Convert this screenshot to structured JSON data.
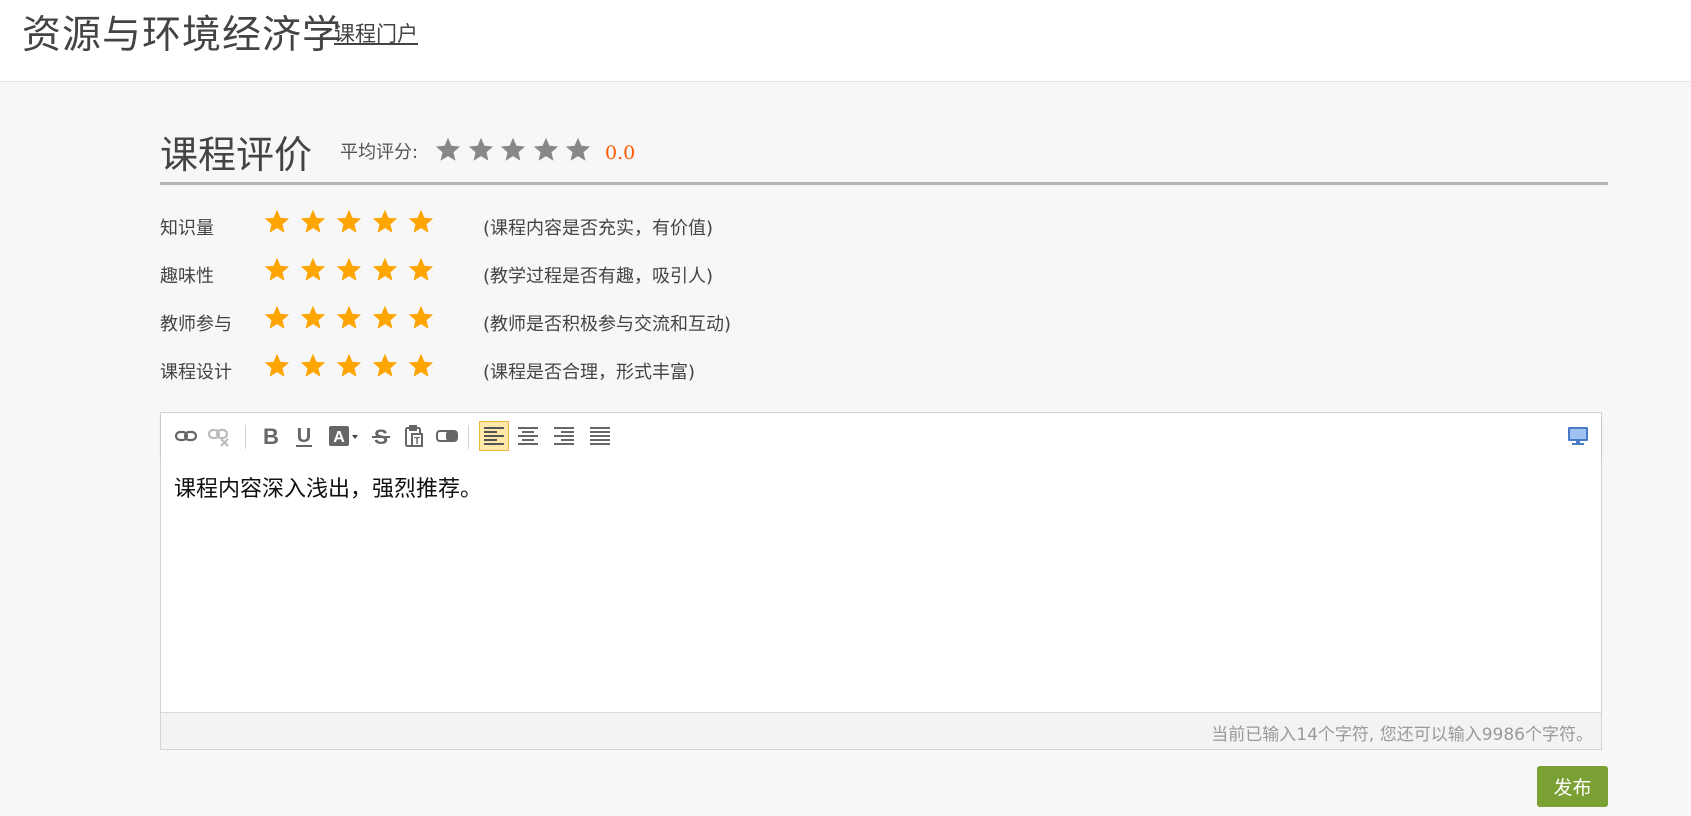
{
  "header": {
    "course_title": "资源与环境经济学",
    "portal_link": "课程门户"
  },
  "evaluation": {
    "title": "课程评价",
    "average_label": "平均评分:",
    "average_score": "0.0",
    "average_stars_filled": 0,
    "max_stars": 5,
    "colors": {
      "star_filled": "#ffa500",
      "star_empty": "#888888",
      "score": "#ff5a00"
    },
    "criteria": [
      {
        "label": "知识量",
        "hint": "(课程内容是否充实，有价值)",
        "stars": 5
      },
      {
        "label": "趣味性",
        "hint": "(教学过程是否有趣，吸引人)",
        "stars": 5
      },
      {
        "label": "教师参与",
        "hint": "(教师是否积极参与交流和互动)",
        "stars": 5
      },
      {
        "label": "课程设计",
        "hint": "(课程是否合理，形式丰富)",
        "stars": 5
      }
    ]
  },
  "editor": {
    "toolbar": [
      "link-icon",
      "unlink-icon",
      "bold-icon",
      "underline-icon",
      "font-color-icon",
      "strikethrough-icon",
      "paste-text-icon",
      "clear-format-icon",
      "align-left-icon",
      "align-center-icon",
      "align-right-icon",
      "align-justify-icon",
      "preview-icon"
    ],
    "active_tool": "align-left-icon",
    "content": "课程内容深入浅出，强烈推荐。",
    "char_count_text": "当前已输入14个字符, 您还可以输入9986个字符。"
  },
  "actions": {
    "publish_label": "发布",
    "publish_color": "#7ba033"
  }
}
